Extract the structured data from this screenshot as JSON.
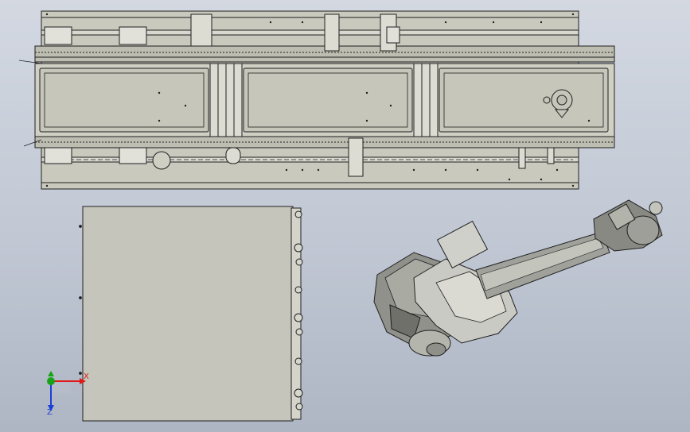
{
  "colors": {
    "viewport_top": "#d3d8e1",
    "viewport_bottom": "#aeb6c4",
    "part_fill": "#cfcfc4",
    "part_fill_dark": "#b7b7ab",
    "edge": "#202020",
    "robot_light": "#d9d9d2",
    "robot_mid": "#9fa19a",
    "robot_dark": "#55574f",
    "axis_x": "#e01818",
    "axis_y": "#17a317",
    "axis_z": "#1a3fd6"
  },
  "triad": {
    "x_label": "X",
    "z_label": "Z"
  },
  "parts": {
    "conveyor": "conveyor-assembly",
    "table": "work-table",
    "robot": "robot-arm"
  }
}
